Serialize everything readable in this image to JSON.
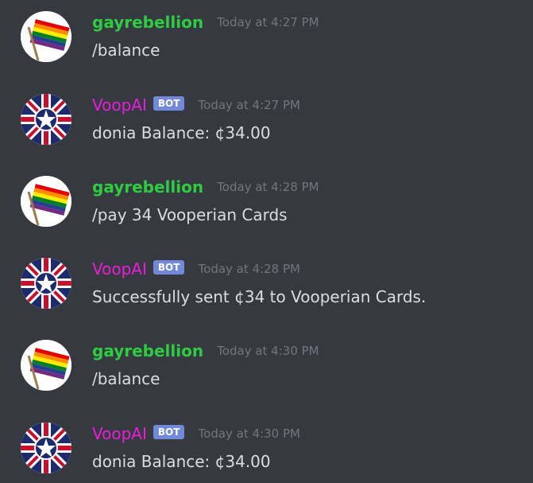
{
  "colors": {
    "background": "#36393f",
    "user_name": "#2ecc40",
    "bot_name": "#e91ed8",
    "bot_badge": "#7289da",
    "timestamp": "#72767d",
    "text": "#dcddde"
  },
  "messages": [
    {
      "author": "gayrebellion",
      "avatar": "rainbow-flag-icon",
      "is_bot": false,
      "timestamp": "Today at 4:27 PM",
      "text": "/balance"
    },
    {
      "author": "VoopAI",
      "avatar": "vooperian-flag-icon",
      "is_bot": true,
      "badge": "BOT",
      "timestamp": "Today at 4:27 PM",
      "text": "donia Balance: ¢34.00"
    },
    {
      "author": "gayrebellion",
      "avatar": "rainbow-flag-icon",
      "is_bot": false,
      "timestamp": "Today at 4:28 PM",
      "text": "/pay 34 Vooperian Cards"
    },
    {
      "author": "VoopAI",
      "avatar": "vooperian-flag-icon",
      "is_bot": true,
      "badge": "BOT",
      "timestamp": "Today at 4:28 PM",
      "text": "Successfully sent ¢34 to Vooperian Cards."
    },
    {
      "author": "gayrebellion",
      "avatar": "rainbow-flag-icon",
      "is_bot": false,
      "timestamp": "Today at 4:30 PM",
      "text": "/balance"
    },
    {
      "author": "VoopAI",
      "avatar": "vooperian-flag-icon",
      "is_bot": true,
      "badge": "BOT",
      "timestamp": "Today at 4:30 PM",
      "text": "donia Balance: ¢34.00"
    }
  ]
}
